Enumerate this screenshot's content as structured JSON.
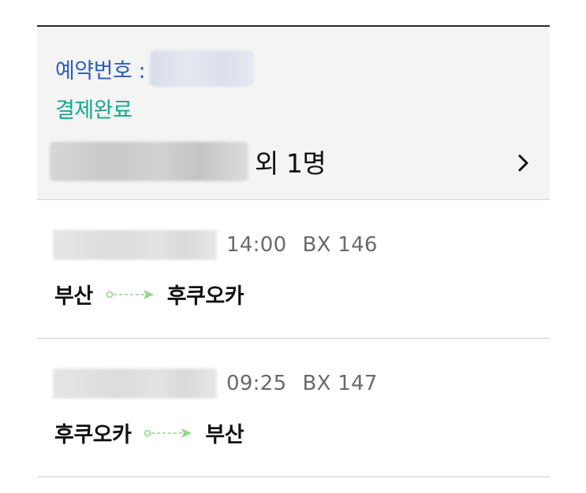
{
  "booking": {
    "reservation_label": "예약번호 :",
    "status": "결제완료",
    "passenger_suffix": "외 1명"
  },
  "flights": [
    {
      "time": "14:00",
      "flight_no": "BX 146",
      "origin": "부산",
      "destination": "후쿠오카"
    },
    {
      "time": "09:25",
      "flight_no": "BX 147",
      "origin": "후쿠오카",
      "destination": "부산"
    }
  ],
  "colors": {
    "reservation_label": "#2d5db8",
    "status": "#16a88a",
    "route_arrow": "#8fd68a"
  },
  "icons": {
    "detail": "chevron-right-icon",
    "route": "route-arrow-icon"
  }
}
